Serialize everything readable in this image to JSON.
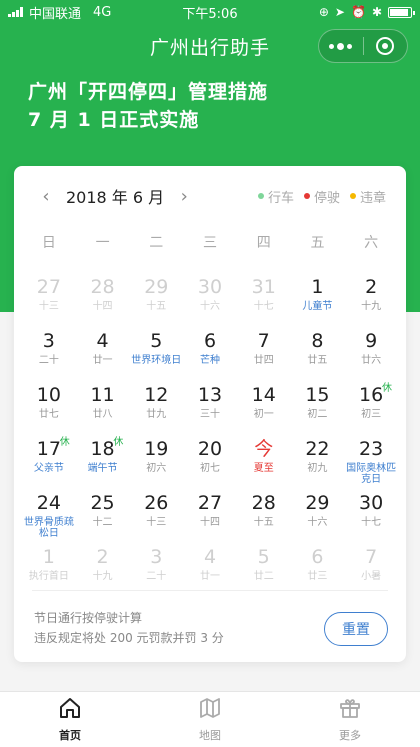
{
  "status_bar": {
    "carrier": "中国联通",
    "network": "4G",
    "time": "下午5:06",
    "battery_level": 0.9
  },
  "nav": {
    "title": "广州出行助手"
  },
  "headline": {
    "line1": "广州「开四停四」管理措施",
    "line2": "7 月 1 日正式实施"
  },
  "calendar": {
    "month_label": "2018 年 6 月",
    "prev_icon": "chevron-left-icon",
    "next_icon": "chevron-right-icon",
    "legend": [
      {
        "label": "行车",
        "color": "#7fd69a"
      },
      {
        "label": "停驶",
        "color": "#e53935"
      },
      {
        "label": "违章",
        "color": "#f5b800"
      }
    ],
    "weekdays": [
      "日",
      "一",
      "二",
      "三",
      "四",
      "五",
      "六"
    ],
    "days": [
      {
        "num": "27",
        "sub": "十三",
        "other": true
      },
      {
        "num": "28",
        "sub": "十四",
        "other": true
      },
      {
        "num": "29",
        "sub": "十五",
        "other": true
      },
      {
        "num": "30",
        "sub": "十六",
        "other": true
      },
      {
        "num": "31",
        "sub": "十七",
        "other": true
      },
      {
        "num": "1",
        "sub": "儿童节",
        "fest": true
      },
      {
        "num": "2",
        "sub": "十九"
      },
      {
        "num": "3",
        "sub": "二十"
      },
      {
        "num": "4",
        "sub": "廿一"
      },
      {
        "num": "5",
        "sub": "世界环境日",
        "fest": true
      },
      {
        "num": "6",
        "sub": "芒种",
        "fest": true
      },
      {
        "num": "7",
        "sub": "廿四"
      },
      {
        "num": "8",
        "sub": "廿五"
      },
      {
        "num": "9",
        "sub": "廿六"
      },
      {
        "num": "10",
        "sub": "廿七"
      },
      {
        "num": "11",
        "sub": "廿八"
      },
      {
        "num": "12",
        "sub": "廿九"
      },
      {
        "num": "13",
        "sub": "三十"
      },
      {
        "num": "14",
        "sub": "初一"
      },
      {
        "num": "15",
        "sub": "初二"
      },
      {
        "num": "16",
        "sub": "初三",
        "badge": "休"
      },
      {
        "num": "17",
        "sub": "父亲节",
        "fest": true,
        "badge": "休"
      },
      {
        "num": "18",
        "sub": "端午节",
        "fest": true,
        "badge": "休"
      },
      {
        "num": "19",
        "sub": "初六"
      },
      {
        "num": "20",
        "sub": "初七"
      },
      {
        "num": "今",
        "sub": "夏至",
        "today": true
      },
      {
        "num": "22",
        "sub": "初九"
      },
      {
        "num": "23",
        "sub": "国际奥林匹克日",
        "fest": true
      },
      {
        "num": "24",
        "sub": "世界骨质疏松日",
        "fest": true
      },
      {
        "num": "25",
        "sub": "十二"
      },
      {
        "num": "26",
        "sub": "十三"
      },
      {
        "num": "27",
        "sub": "十四"
      },
      {
        "num": "28",
        "sub": "十五"
      },
      {
        "num": "29",
        "sub": "十六"
      },
      {
        "num": "30",
        "sub": "十七"
      },
      {
        "num": "1",
        "sub": "执行首日",
        "other": true
      },
      {
        "num": "2",
        "sub": "十九",
        "other": true
      },
      {
        "num": "3",
        "sub": "二十",
        "other": true
      },
      {
        "num": "4",
        "sub": "廿一",
        "other": true
      },
      {
        "num": "5",
        "sub": "廿二",
        "other": true
      },
      {
        "num": "6",
        "sub": "廿三",
        "other": true
      },
      {
        "num": "7",
        "sub": "小暑",
        "other": true
      }
    ],
    "rules_line1": "节日通行按停驶计算",
    "rules_line2": "违反规定将处 200 元罚款并罚 3 分",
    "reset_label": "重置"
  },
  "tabs": [
    {
      "label": "首页",
      "icon": "home-icon",
      "active": true
    },
    {
      "label": "地图",
      "icon": "map-icon",
      "active": false
    },
    {
      "label": "更多",
      "icon": "gift-icon",
      "active": false
    }
  ]
}
